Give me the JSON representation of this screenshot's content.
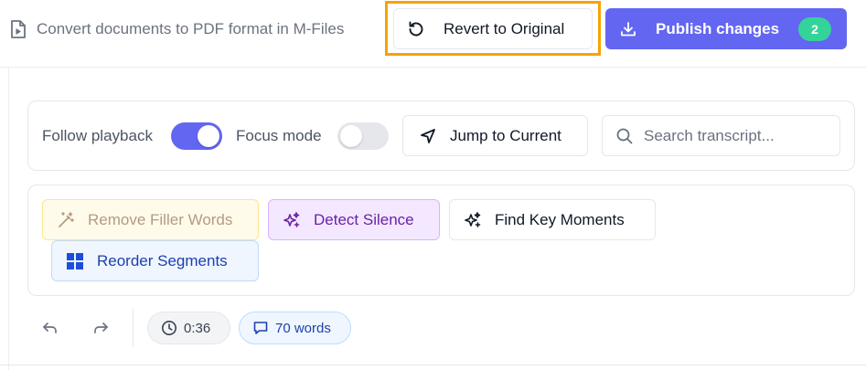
{
  "header": {
    "document_title": "Convert documents to PDF format in M-Files",
    "revert_label": "Revert to Original",
    "publish_label": "Publish changes",
    "pending_changes_count": "2"
  },
  "controls": {
    "follow_playback_label": "Follow playback",
    "follow_playback_on": true,
    "focus_mode_label": "Focus mode",
    "focus_mode_on": false,
    "jump_label": "Jump to Current",
    "search_placeholder": "Search transcript...",
    "search_value": ""
  },
  "tools": {
    "remove_filler_label": "Remove Filler Words",
    "detect_silence_label": "Detect Silence",
    "find_key_moments_label": "Find Key Moments",
    "reorder_segments_label": "Reorder Segments"
  },
  "footer": {
    "duration": "0:36",
    "word_count": "70 words"
  },
  "colors": {
    "accent": "#6366f1",
    "highlight_border": "#f5a300",
    "badge": "#34d399"
  }
}
